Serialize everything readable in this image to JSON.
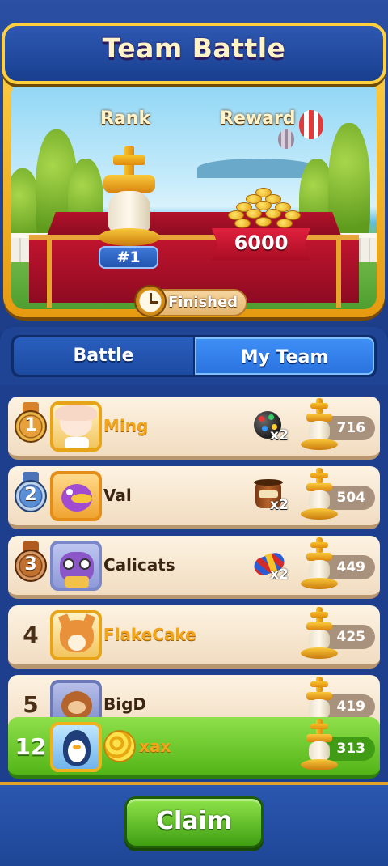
{
  "header": {
    "title": "Team Battle",
    "rank_label": "Rank",
    "reward_label": "Reward",
    "rank_value": "#1",
    "reward_value": "6000",
    "status": "Finished"
  },
  "tabs": [
    {
      "label": "Battle",
      "active": false
    },
    {
      "label": "My Team",
      "active": true
    }
  ],
  "leaderboard": [
    {
      "rank": "1",
      "name": "Ming",
      "booster": "color-bomb",
      "booster_count": "x2",
      "score": "716",
      "medal": "gold"
    },
    {
      "rank": "2",
      "name": "Val",
      "booster": "boom-barrel",
      "booster_count": "x2",
      "score": "504",
      "medal": "silver"
    },
    {
      "rank": "3",
      "name": "Calicats",
      "booster": "rocket",
      "booster_count": "x2",
      "score": "449",
      "medal": "bronze"
    },
    {
      "rank": "4",
      "name": "FlakeCake",
      "booster": "",
      "booster_count": "",
      "score": "425",
      "medal": ""
    },
    {
      "rank": "5",
      "name": "BigD",
      "booster": "",
      "booster_count": "",
      "score": "419",
      "medal": ""
    }
  ],
  "my_entry": {
    "rank": "12",
    "name": "xax",
    "score": "313",
    "badge": "golden-snail-badge"
  },
  "claim_label": "Claim",
  "colors": {
    "accent_gold": "#f2a51a",
    "panel_blue": "#1d3f8d",
    "claim_green": "#52b417"
  }
}
